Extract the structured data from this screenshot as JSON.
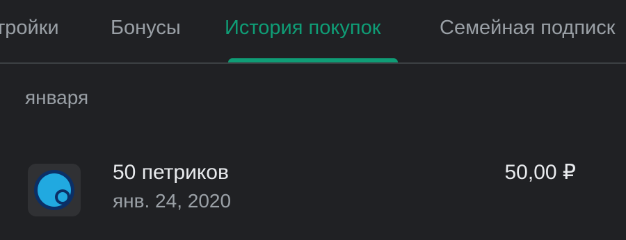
{
  "tabs": [
    {
      "label": "тройки",
      "active": false
    },
    {
      "label": "Бонусы",
      "active": false
    },
    {
      "label": "История покупок",
      "active": true
    },
    {
      "label": "Семейная подписк",
      "active": false
    }
  ],
  "colors": {
    "accent": "#0f9d76",
    "background": "#202124",
    "primary_text": "#e8eaed",
    "secondary_text": "#9aa0a6"
  },
  "purchase_history": {
    "section_label": "января",
    "items": [
      {
        "icon": "app-icon-blue-circle",
        "title": "50 петриков",
        "date": "янв. 24, 2020",
        "price": "50,00 ₽"
      }
    ]
  }
}
